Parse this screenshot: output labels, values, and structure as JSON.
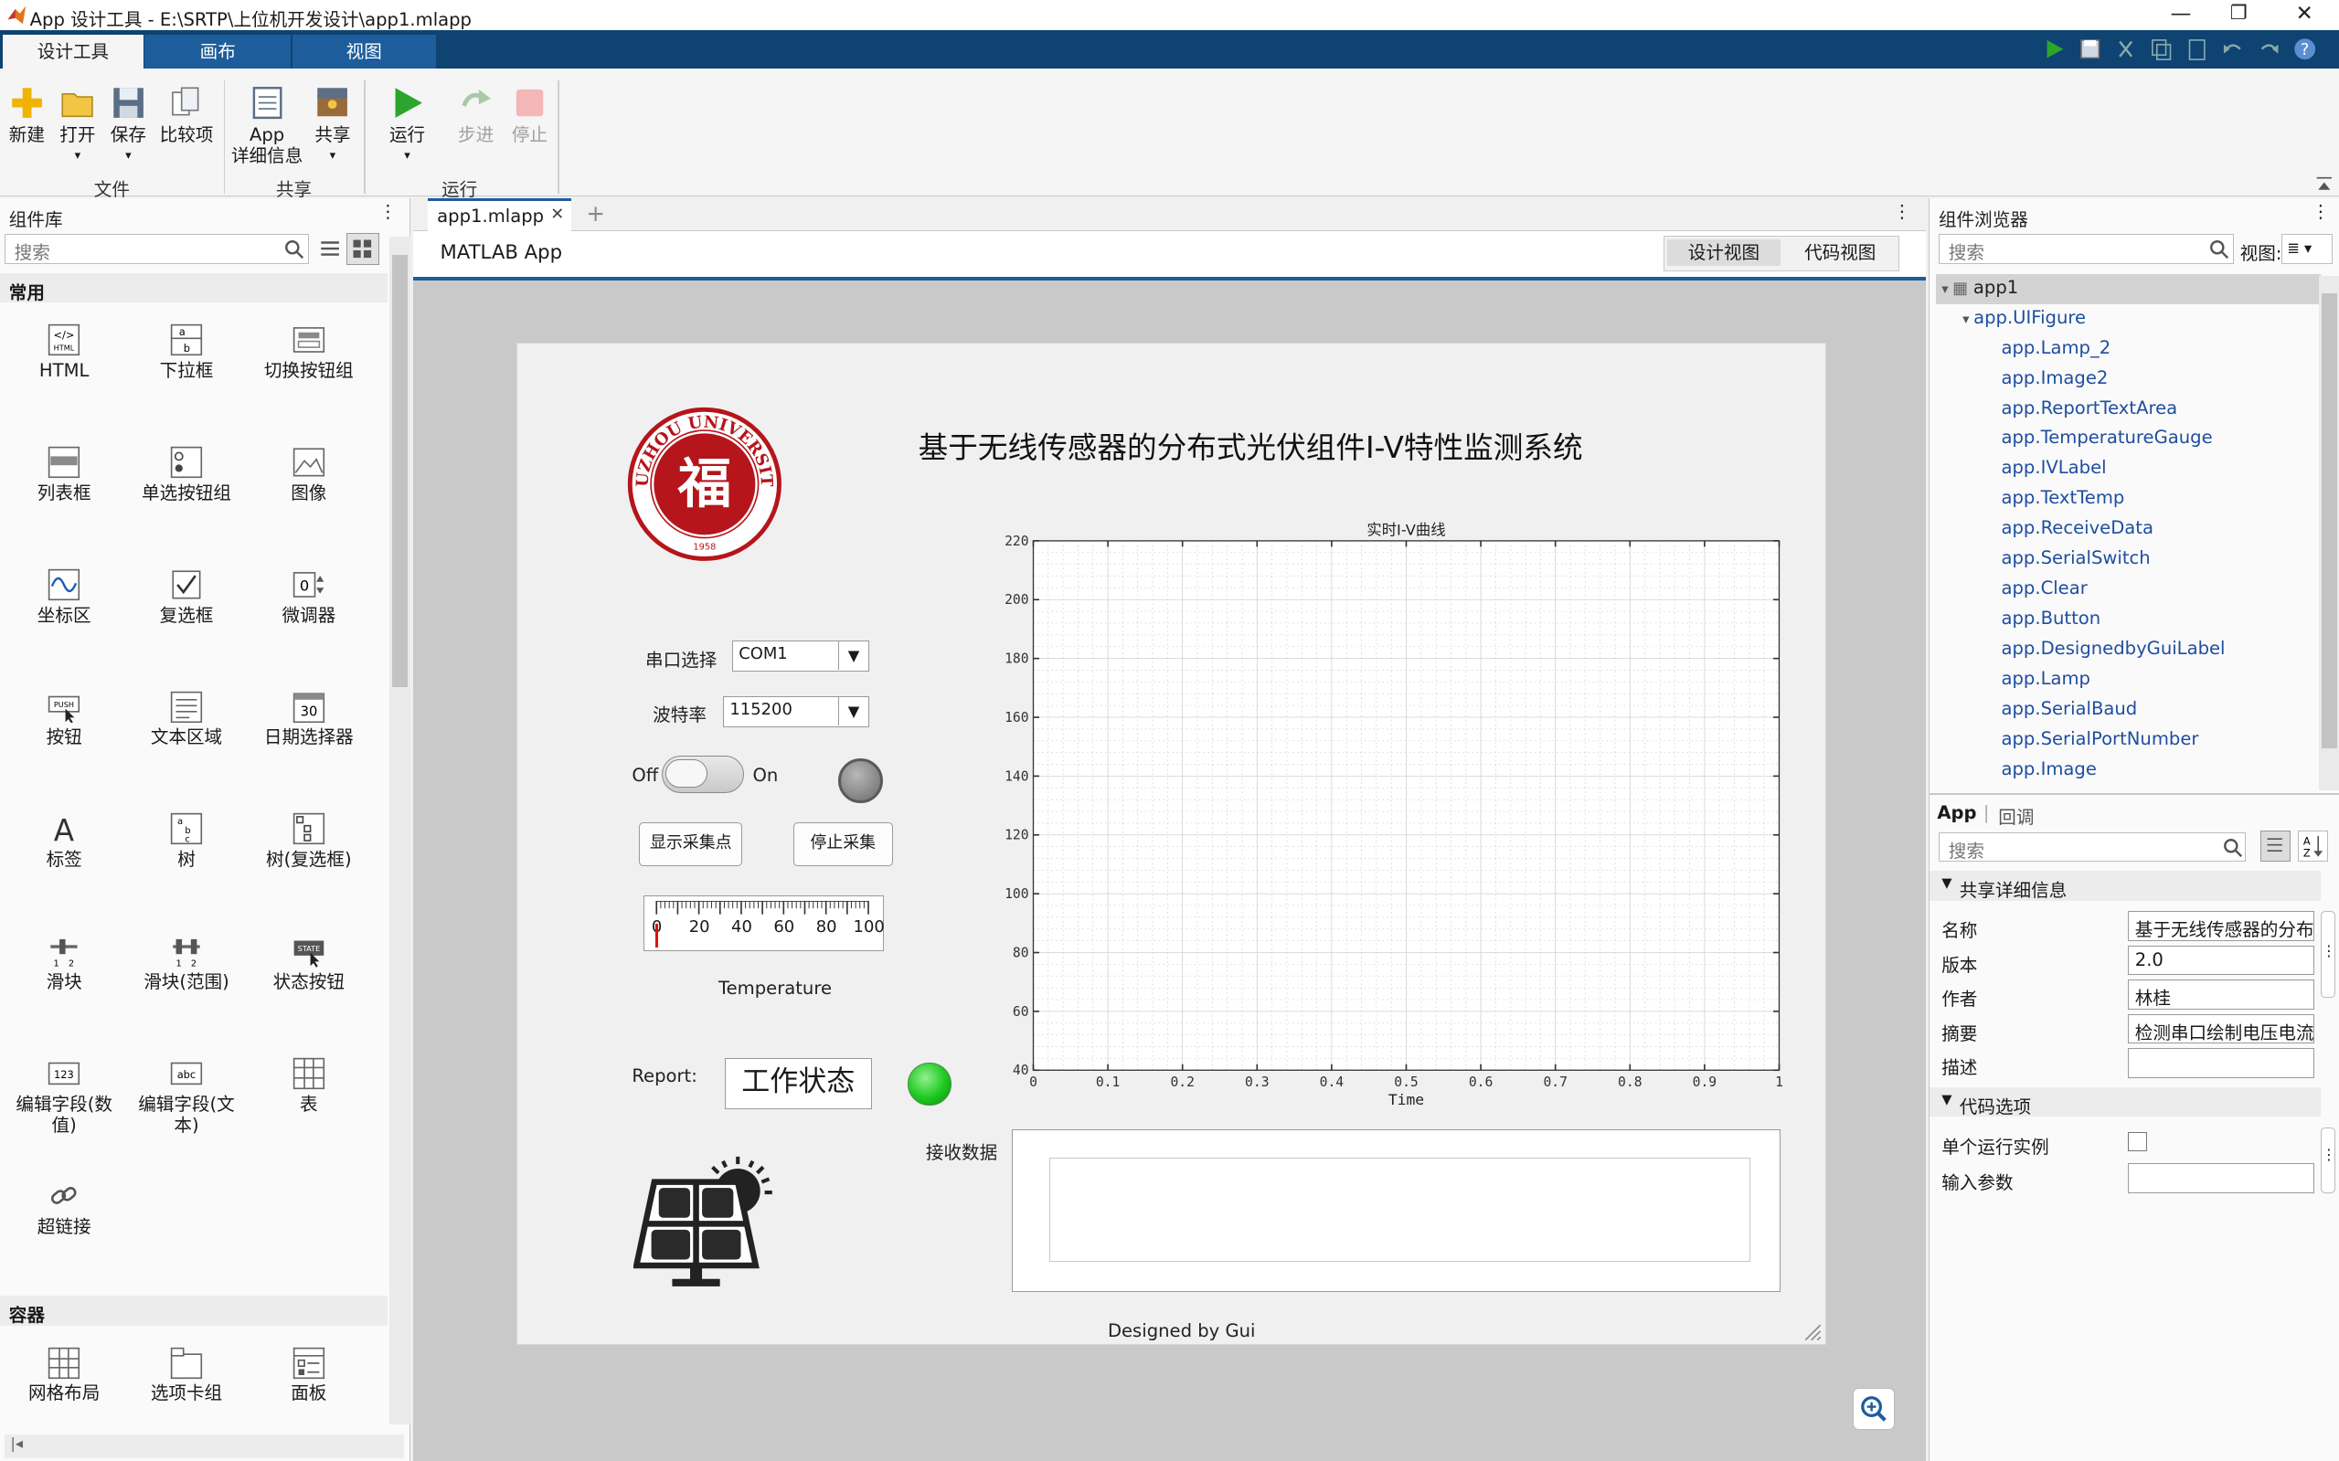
{
  "window": {
    "title": "App 设计工具 - E:\\SRTP\\上位机开发设计\\app1.mlapp",
    "minimize": "—",
    "restore": "❐",
    "close": "✕"
  },
  "ribbon": {
    "tabs": [
      "设计工具",
      "画布",
      "视图"
    ],
    "buttons": {
      "new": "新建",
      "open": "打开",
      "save": "保存",
      "compare": "比较项",
      "app_details_1": "App",
      "app_details_2": "详细信息",
      "share": "共享",
      "run": "运行",
      "step": "步进",
      "stop": "停止"
    },
    "groups": {
      "file": "文件",
      "share": "共享",
      "run": "运行"
    }
  },
  "library": {
    "title": "组件库",
    "search_placeholder": "搜索",
    "section_common": "常用",
    "section_container": "容器",
    "items": [
      "HTML",
      "下拉框",
      "切换按钮组",
      "列表框",
      "单选按钮组",
      "图像",
      "坐标区",
      "复选框",
      "微调器",
      "按钮",
      "文本区域",
      "日期选择器",
      "标签",
      "树",
      "树(复选框)",
      "滑块",
      "滑块(范围)",
      "状态按钮",
      "编辑字段(数",
      "值)",
      "编辑字段(文",
      "本)",
      "表",
      "超链接"
    ],
    "container_items": [
      "网格布局",
      "选项卡组",
      "面板"
    ]
  },
  "document": {
    "tab": "app1.mlapp",
    "close": "✕",
    "add": "+",
    "canvas_title": "MATLAB App",
    "design_view": "设计视图",
    "code_view": "代码视图"
  },
  "app": {
    "title": "基于无线传感器的分布式光伏组件I-V特性监测系统",
    "logo": {
      "outer": "FUZHOU UNIVERSITY",
      "center": "福",
      "year": "1958"
    },
    "serial_label": "串口选择",
    "serial_value": "COM1",
    "baud_label": "波特率",
    "baud_value": "115200",
    "switch_off": "Off",
    "switch_on": "On",
    "btn_show": "显示采集点",
    "btn_stop": "停止采集",
    "gauge_ticks": [
      "0",
      "20",
      "40",
      "60",
      "80",
      "100"
    ],
    "gauge_value": 0,
    "gauge_label": "Temperature",
    "report_label": "Report:",
    "report_value": "工作状态",
    "receive_label": "接收数据",
    "designed_by": "Designed by Gui",
    "colors": {
      "lamp_green": "#1ec81e",
      "lamp_gray": "#7d7d7d",
      "logo_red": "#b5151b"
    }
  },
  "chart_data": {
    "type": "line",
    "title": "实时I-V曲线",
    "xlabel": "Time",
    "ylabel": "",
    "xlim": [
      0,
      1
    ],
    "ylim": [
      40,
      220
    ],
    "x_ticks": [
      "0",
      "0.1",
      "0.2",
      "0.3",
      "0.4",
      "0.5",
      "0.6",
      "0.7",
      "0.8",
      "0.9",
      "1"
    ],
    "y_ticks": [
      "40",
      "60",
      "80",
      "100",
      "120",
      "140",
      "160",
      "180",
      "200",
      "220"
    ],
    "grid": "on (major and minor)",
    "series": []
  },
  "browser": {
    "title": "组件浏览器",
    "search_placeholder": "搜索",
    "view_label": "视图:",
    "tree": [
      "app1",
      "app.UIFigure",
      "app.Lamp_2",
      "app.Image2",
      "app.ReportTextArea",
      "app.TemperatureGauge",
      "app.IVLabel",
      "app.TextTemp",
      "app.ReceiveData",
      "app.SerialSwitch",
      "app.Clear",
      "app.Button",
      "app.DesignedbyGuiLabel",
      "app.Lamp",
      "app.SerialBaud",
      "app.SerialPortNumber",
      "app.Image"
    ]
  },
  "inspector": {
    "tab_app": "App",
    "tab_callback": "回调",
    "sep": "|",
    "search_placeholder": "搜索",
    "section_share": "共享详细信息",
    "section_code": "代码选项",
    "fields": {
      "name_label": "名称",
      "name_value": "基于无线传感器的分布式",
      "version_label": "版本",
      "version_value": "2.0",
      "author_label": "作者",
      "author_value": "林桂",
      "summary_label": "摘要",
      "summary_value": "检测串口绘制电压电流",
      "desc_label": "描述",
      "desc_value": "",
      "single_label": "单个运行实例",
      "input_label": "输入参数",
      "input_value": ""
    }
  }
}
